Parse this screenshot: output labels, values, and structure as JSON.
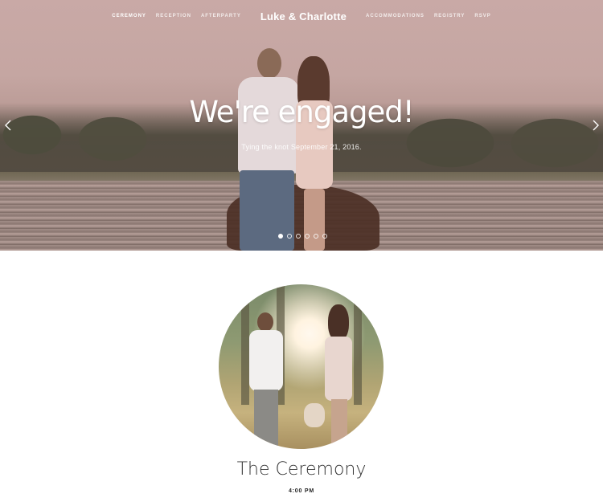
{
  "nav": {
    "left_links": [
      "Ceremony",
      "Reception",
      "Afterparty"
    ],
    "brand": "Luke & Charlotte",
    "right_links": [
      "Accommodations",
      "Registry",
      "RSVP"
    ],
    "active": "Ceremony"
  },
  "hero": {
    "headline": "We're engaged!",
    "subline": "Tying the knot September 21, 2016.",
    "prev_icon": "chevron-left-icon",
    "next_icon": "chevron-right-icon",
    "slide_count": 6,
    "active_slide": 1
  },
  "section": {
    "title": "The Ceremony",
    "time": "4:00 PM"
  },
  "colors": {
    "text_white": "#ffffff",
    "title_text": "#333333"
  }
}
